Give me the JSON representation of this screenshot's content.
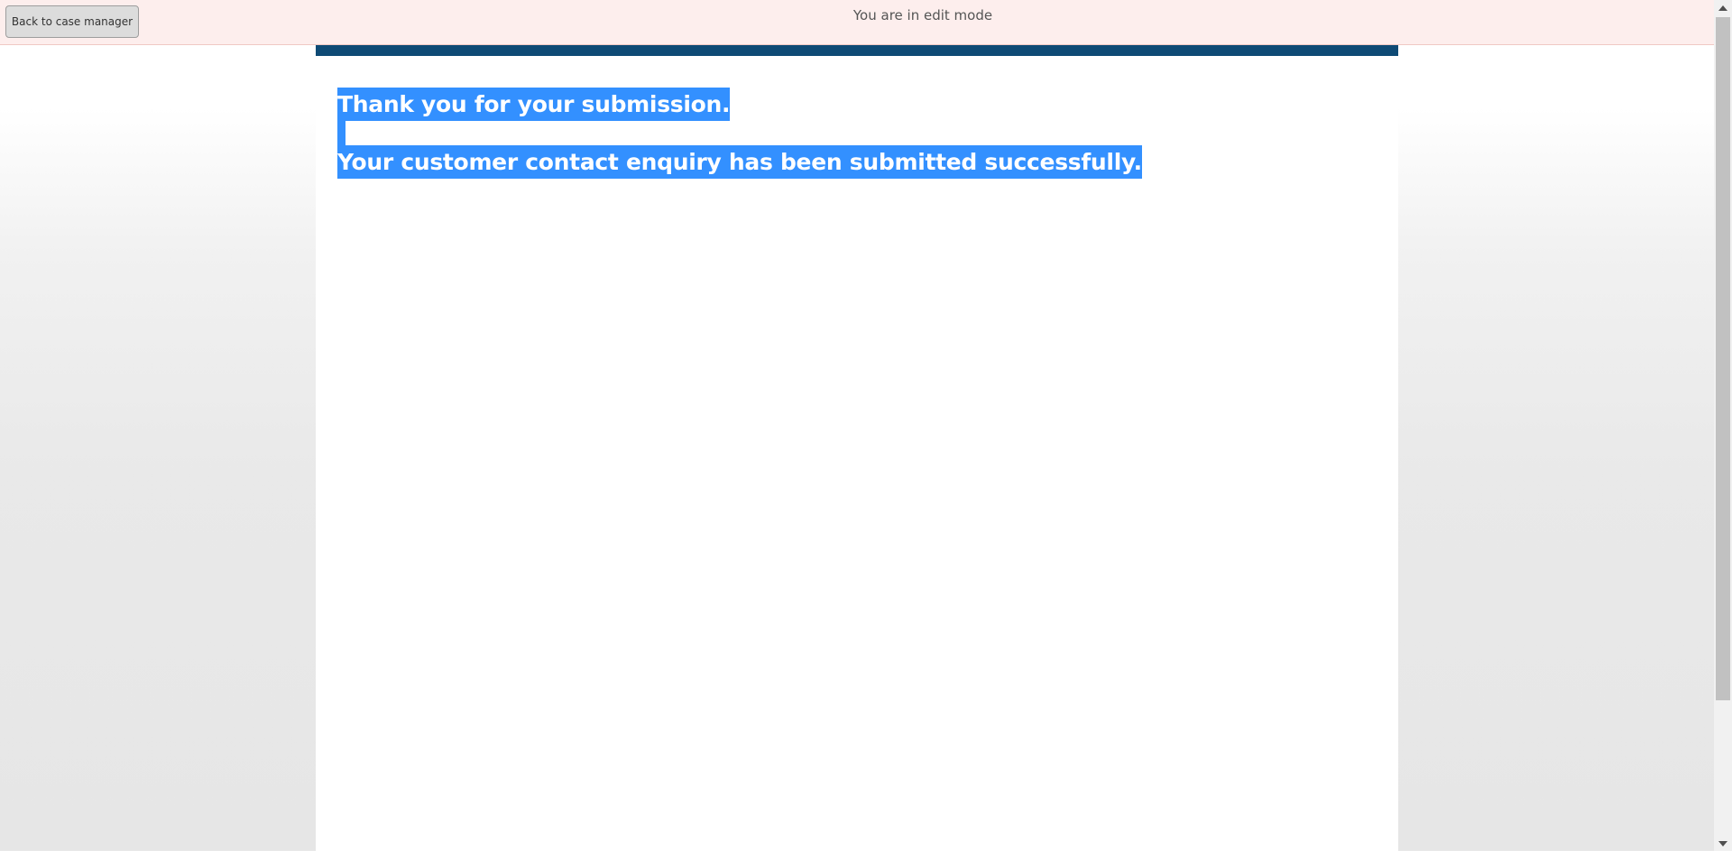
{
  "topbar": {
    "back_button_label": "Back to case manager",
    "mode_text": "You are in edit mode"
  },
  "content": {
    "heading": "Thank you for your submission.",
    "message": "Your customer contact enquiry has been submitted successfully."
  },
  "colors": {
    "topbar_bg": "#fdeeed",
    "page_accent": "#0e4a75",
    "selection": "#3390ff"
  },
  "icons": {
    "scroll_up": "triangle-up",
    "scroll_down": "triangle-down"
  }
}
